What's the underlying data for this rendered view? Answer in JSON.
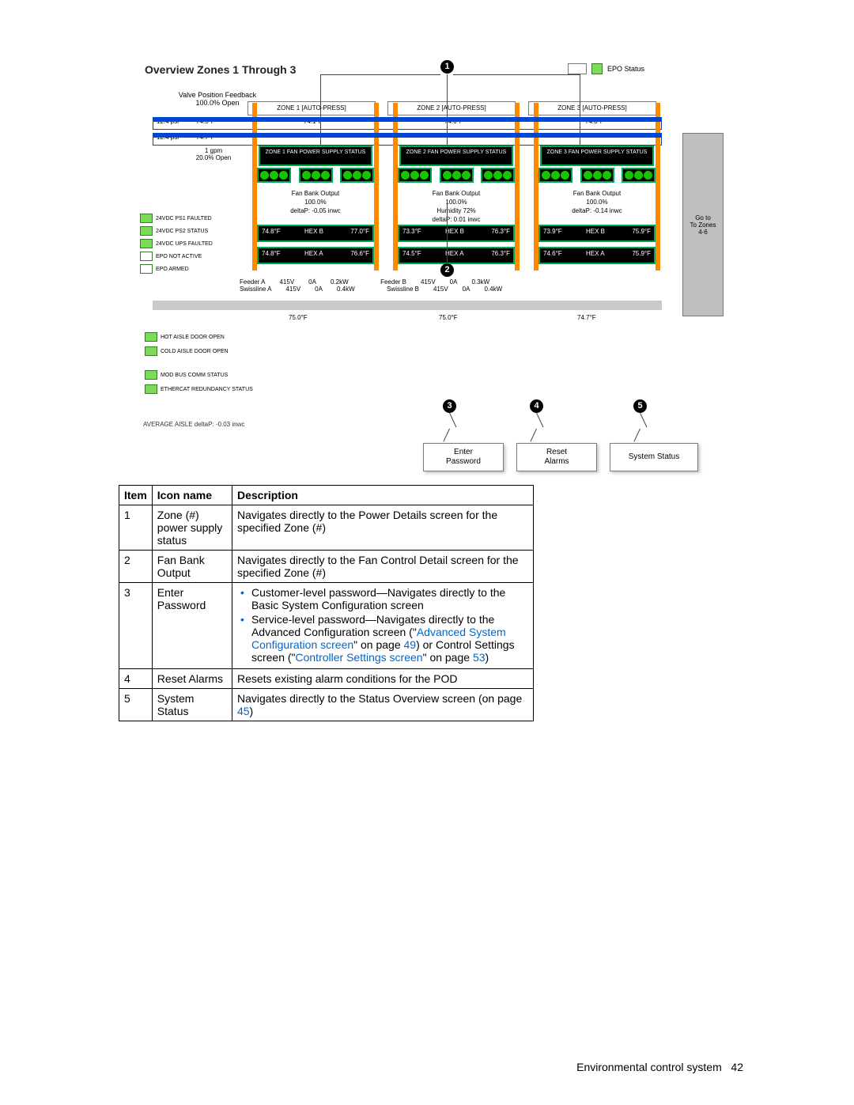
{
  "title": "Overview Zones 1 Through 3",
  "epo_status_label": "EPO Status",
  "valve_feedback_label": "Valve Position Feedback",
  "valve_feedback_value": "100.0% Open",
  "zone_headers": [
    "ZONE 1 [AUTO-PRESS]",
    "ZONE 2 [AUTO-PRESS]",
    "ZONE 3 [AUTO-PRESS]"
  ],
  "psi_rows": [
    {
      "psi": "12.4 psi",
      "tempL": "74.5°F",
      "t1": "74.1°F",
      "t2": "74.6°F",
      "t3": "74.3°F"
    },
    {
      "psi": "12.4 psi",
      "tempL": "74.7°F"
    }
  ],
  "gpm_label": "1 gpm",
  "gpm_open": "20.0% Open",
  "go_label": "Go to\nTo Zones\n4-6",
  "zones": [
    {
      "ps": "ZONE 1 FAN POWER SUPPLY STATUS",
      "fbo": "Fan Bank Output\n100.0%",
      "deltap": "deltaP: -0.05 inwc",
      "hexb": {
        "l": "74.8°F",
        "m": "HEX B",
        "r": "77.0°F"
      },
      "hexa": {
        "l": "74.8°F",
        "m": "HEX A",
        "r": "76.6°F"
      }
    },
    {
      "ps": "ZONE 2 FAN POWER SUPPLY STATUS",
      "fbo": "Fan Bank Output\n100.0%\nHumidity 72%",
      "deltap": "deltaP: 0.01 inwc",
      "hexb": {
        "l": "73.3°F",
        "m": "HEX B",
        "r": "76.3°F"
      },
      "hexa": {
        "l": "74.5°F",
        "m": "HEX A",
        "r": "76.3°F"
      }
    },
    {
      "ps": "ZONE 3 FAN POWER SUPPLY STATUS",
      "fbo": "Fan Bank Output\n100.0%",
      "deltap": "deltaP: -0.14 inwc",
      "hexb": {
        "l": "73.9°F",
        "m": "HEX B",
        "r": "75.9°F"
      },
      "hexa": {
        "l": "74.6°F",
        "m": "HEX A",
        "r": "75.9°F"
      }
    }
  ],
  "left_legend": [
    "24VDC PS1 FAULTED",
    "24VDC PS2 STATUS",
    "24VDC UPS FAULTED",
    "EPO NOT ACTIVE",
    "EPO ARMED"
  ],
  "feeder_rows": [
    [
      "Feeder A",
      "415V",
      "0A",
      "0.2kW",
      "Feeder B",
      "415V",
      "0A",
      "0.3kW"
    ],
    [
      "Swissline A",
      "415V",
      "0A",
      "0.4kW",
      "Swissline B",
      "415V",
      "0A",
      "0.4kW"
    ]
  ],
  "bottom_temps": [
    "75.0°F",
    "75.0°F",
    "74.7°F"
  ],
  "under_legend": [
    "HOT AISLE DOOR OPEN",
    "COLD AISLE DOOR OPEN",
    "MOD BUS COMM STATUS",
    "ETHERCAT REDUNDANCY STATUS"
  ],
  "avg_deltap": "AVERAGE AISLE deltaP: -0.03 inwc",
  "btn_enter": "Enter\nPassword",
  "btn_reset": "Reset\nAlarms",
  "btn_status": "System Status",
  "callouts": [
    "1",
    "2",
    "3",
    "4",
    "5"
  ],
  "table": {
    "headers": [
      "Item",
      "Icon name",
      "Description"
    ],
    "rows": [
      {
        "item": "1",
        "name": "Zone (#) power supply status",
        "desc": "Navigates directly to the Power Details screen for the specified Zone (#)"
      },
      {
        "item": "2",
        "name": "Fan Bank Output",
        "desc": "Navigates directly to the Fan Control Detail screen for the specified Zone (#)"
      },
      {
        "item": "3",
        "name": "Enter Password",
        "desc": "LIST"
      },
      {
        "item": "4",
        "name": "Reset Alarms",
        "desc": "Resets existing alarm conditions for the POD"
      },
      {
        "item": "5",
        "name": "System Status",
        "desc": "Navigates directly to the Status Overview screen (on page "
      }
    ],
    "row3_list": [
      {
        "pre": "Customer-level password—Navigates directly to the Basic System Configuration screen"
      },
      {
        "pre": "Service-level password—Navigates directly to the Advanced Configuration screen (\"",
        "link1": "Advanced System Configuration screen",
        "mid": "\" on page ",
        "pg1": "49",
        "post": ") or Control Settings screen (\"",
        "link2": "Controller Settings screen",
        "mid2": "\" on page ",
        "pg2": "53",
        "end": ")"
      }
    ],
    "row5_pg": "45",
    "row5_end": ")"
  },
  "footer_label": "Environmental control system",
  "footer_pg": "42"
}
